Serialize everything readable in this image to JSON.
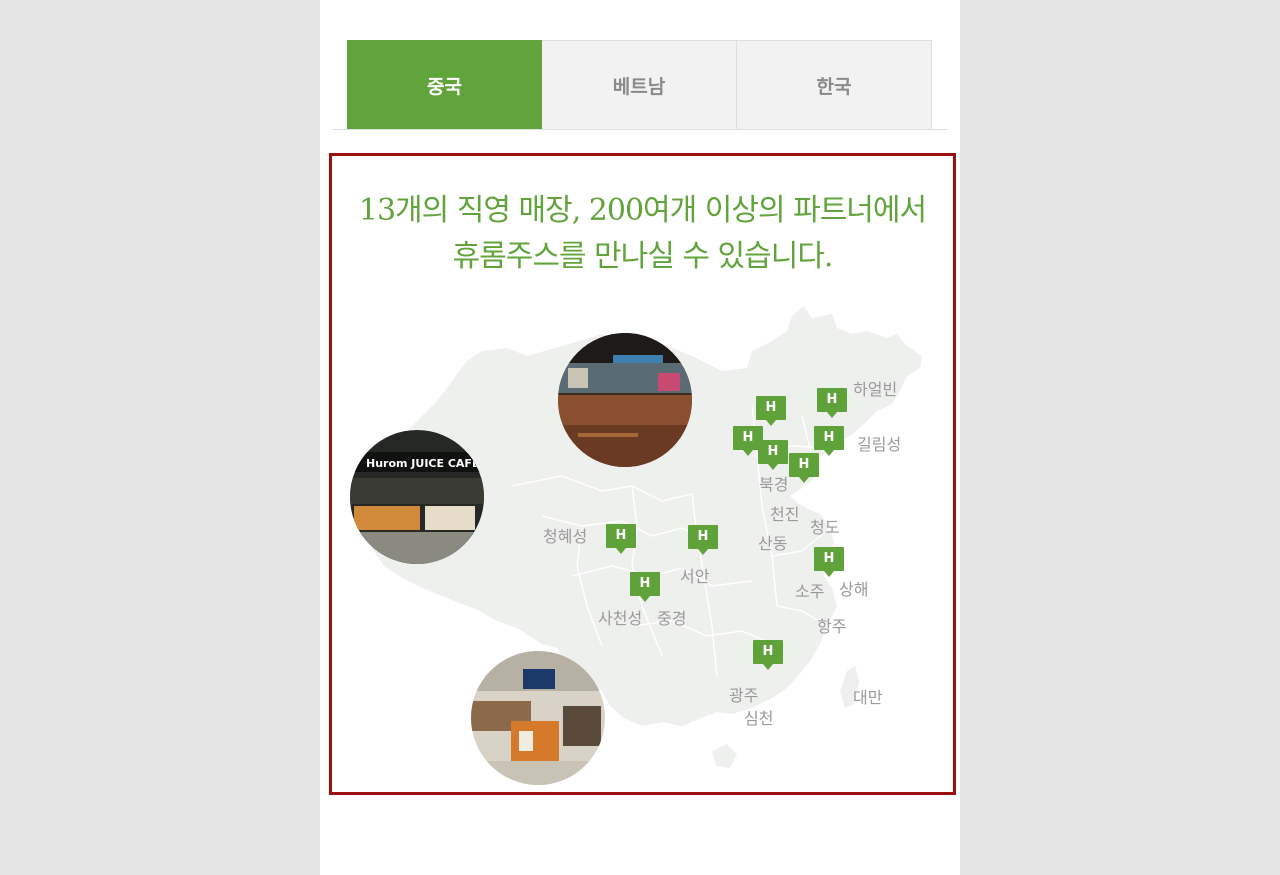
{
  "tabs": [
    {
      "label": "중국",
      "active": true
    },
    {
      "label": "베트남",
      "active": false
    },
    {
      "label": "한국",
      "active": false
    }
  ],
  "headline": {
    "line1": "13개의 직영 매장, 200여개 이상의 파트너에서",
    "line2": "휴롬주스를 만나실 수 있습니다."
  },
  "colors": {
    "accent_green": "#62a43c",
    "panel_border": "#9b1111",
    "map_fill": "#eef0ed",
    "city_text": "#9a9a9a"
  },
  "map": {
    "marker_icon": "H",
    "cities": {
      "harbin": "하얼빈",
      "jilin": "길림성",
      "beijing": "북경",
      "tianjin": "천진",
      "qingdao": "청도",
      "shandong": "산동",
      "qinghai": "청혜성",
      "xian": "서안",
      "suzhou": "소주",
      "shanghai": "상해",
      "sichuan": "사천성",
      "chongqing": "중경",
      "hangzhou": "항주",
      "guangzhou": "광주",
      "shenzhen": "심천",
      "taiwan": "대만"
    },
    "store_sign_text": "Hurom JUICE CAFE"
  }
}
